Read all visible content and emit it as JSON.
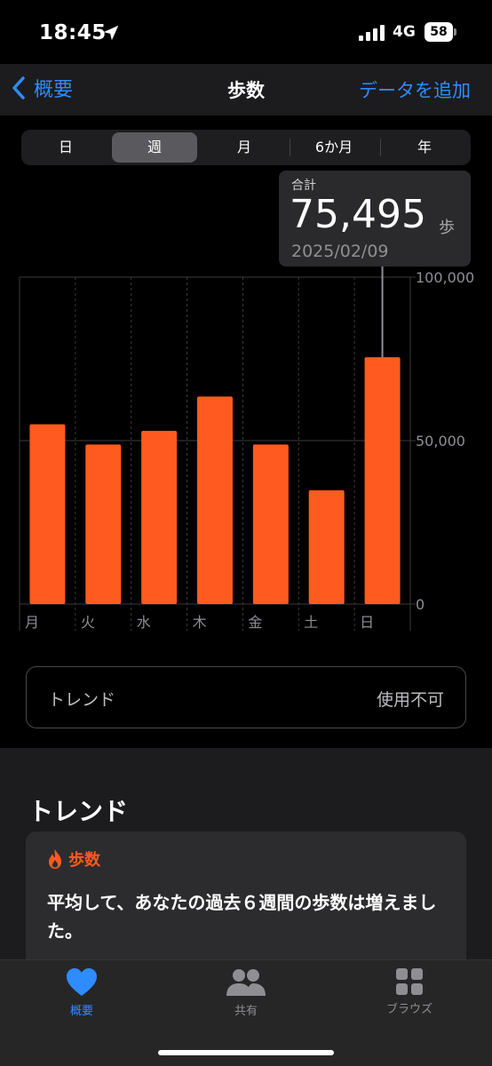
{
  "status": {
    "time": "18:45",
    "network": "4G",
    "battery": "58"
  },
  "nav": {
    "back_label": "概要",
    "title": "歩数",
    "add_label": "データを追加"
  },
  "segments": [
    "日",
    "週",
    "月",
    "6か月",
    "年"
  ],
  "active_segment": "週",
  "tooltip": {
    "label": "合計",
    "value": "75,495",
    "unit": "歩",
    "date": "2025/02/09"
  },
  "chart_data": {
    "type": "bar",
    "categories": [
      "月",
      "火",
      "水",
      "木",
      "金",
      "土",
      "日"
    ],
    "values": [
      55000,
      48800,
      53000,
      63500,
      48800,
      34800,
      75495
    ],
    "ylim": [
      0,
      100000
    ],
    "yticks": [
      "0",
      "50,000",
      "100,000"
    ],
    "highlight_index": 6,
    "bar_color": "#ff5a1f",
    "grid": true
  },
  "trend_row": {
    "label": "トレンド",
    "value": "使用不可"
  },
  "trends_section": {
    "title": "トレンド",
    "card_label": "歩数",
    "card_text": "平均して、あなたの過去６週間の歩数は増えました。"
  },
  "tabbar": [
    {
      "label": "概要",
      "icon": "heart-icon"
    },
    {
      "label": "共有",
      "icon": "people-icon"
    },
    {
      "label": "ブラウズ",
      "icon": "grid-icon"
    }
  ],
  "colors": {
    "accent": "#2f8cff",
    "bar": "#ff5a1f",
    "background": "#000000"
  }
}
